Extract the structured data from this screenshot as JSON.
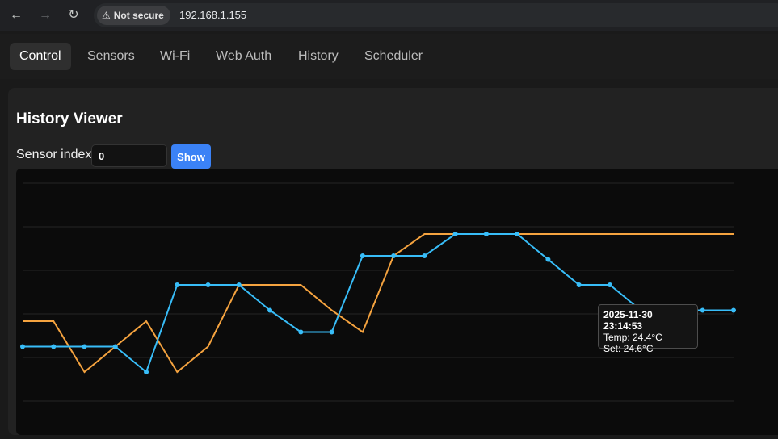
{
  "browser": {
    "security_label": "Not secure",
    "url": "192.168.1.155"
  },
  "tabs": [
    {
      "label": "Control",
      "active": true
    },
    {
      "label": "Sensors",
      "active": false
    },
    {
      "label": "Wi-Fi",
      "active": false
    },
    {
      "label": "Web Auth",
      "active": false
    },
    {
      "label": "History",
      "active": false
    },
    {
      "label": "Scheduler",
      "active": false
    }
  ],
  "history": {
    "title": "History Viewer",
    "sensor_label": "Sensor index",
    "sensor_value": "0",
    "show_label": "Show"
  },
  "tooltip": {
    "time": "2025-11-30 23:14:53",
    "temp": "Temp: 24.4°C",
    "set": "Set: 24.6°C"
  },
  "chart_data": {
    "type": "line",
    "grid": true,
    "ylim": [
      0,
      6
    ],
    "x": [
      0,
      1,
      2,
      3,
      4,
      5,
      6,
      7,
      8,
      9,
      10,
      11,
      12,
      13,
      14,
      15,
      16,
      17,
      18,
      19,
      20,
      21,
      22,
      23
    ],
    "series": [
      {
        "color": "#38bdf8",
        "markers": true,
        "values": [
          1.5,
          1.5,
          1.5,
          1.5,
          0.8,
          3.2,
          3.2,
          3.2,
          2.5,
          1.9,
          1.9,
          4.0,
          4.0,
          4.0,
          4.6,
          4.6,
          4.6,
          3.9,
          3.2,
          3.2,
          2.5,
          2.5,
          2.5,
          2.5
        ]
      },
      {
        "color": "#f5a33f",
        "markers": false,
        "values": [
          2.2,
          2.2,
          0.8,
          1.5,
          2.2,
          0.8,
          1.5,
          3.2,
          3.2,
          3.2,
          2.5,
          1.9,
          4.0,
          4.6,
          4.6,
          4.6,
          4.6,
          4.6,
          4.6,
          4.6,
          4.6,
          4.6,
          4.6,
          4.6
        ]
      }
    ]
  },
  "colors": {
    "accent": "#3b82f6",
    "series_blue": "#38bdf8",
    "series_orange": "#f5a33f"
  }
}
